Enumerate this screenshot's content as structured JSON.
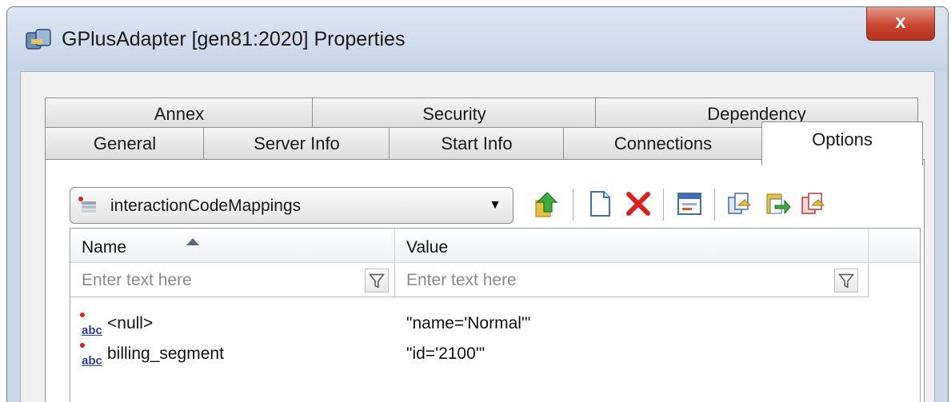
{
  "window": {
    "title": "GPlusAdapter [gen81:2020] Properties",
    "close_label": "x",
    "accent_close": "#c9452f"
  },
  "tabs": {
    "row1": [
      "Annex",
      "Security",
      "Dependency"
    ],
    "row2": [
      "General",
      "Server Info",
      "Start Info",
      "Connections",
      "Options"
    ],
    "active": "Options"
  },
  "options": {
    "section_select": "interactionCodeMappings",
    "toolbar_icons": [
      "move-up-icon",
      "new-item-icon",
      "delete-icon",
      "edit-dialog-icon",
      "copy-icon",
      "paste-icon",
      "export-icon"
    ]
  },
  "grid": {
    "columns": [
      "Name",
      "Value"
    ],
    "sort_column": "Name",
    "sort_direction": "ascending",
    "filter_placeholder": "Enter text here",
    "rows": [
      {
        "name": "<null>",
        "value": "\"name='Normal'\""
      },
      {
        "name": "billing_segment",
        "value": "\"id='2100'\""
      }
    ]
  }
}
